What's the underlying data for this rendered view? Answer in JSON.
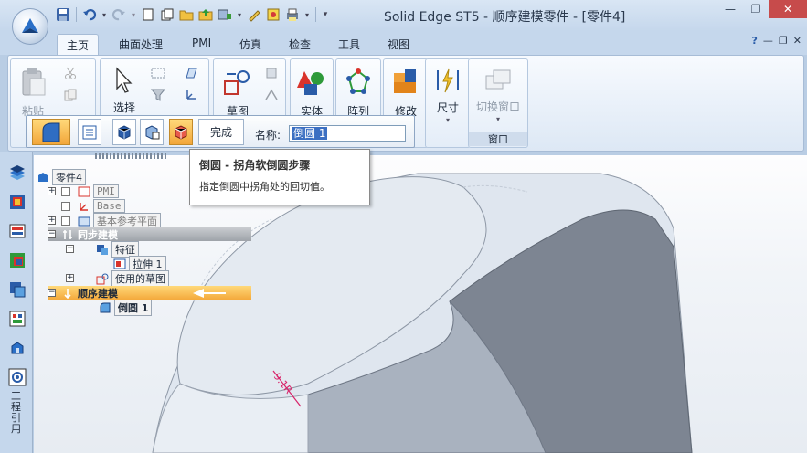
{
  "app": {
    "title": "Solid Edge ST5 - 顺序建模零件 - [零件4]"
  },
  "window_controls": {
    "minimize": "—",
    "restore": "❐",
    "close": "✕"
  },
  "tabs": [
    {
      "label": "主页",
      "active": true
    },
    {
      "label": "曲面处理"
    },
    {
      "label": "PMI"
    },
    {
      "label": "仿真"
    },
    {
      "label": "检查"
    },
    {
      "label": "工具"
    },
    {
      "label": "视图"
    }
  ],
  "tabs_right": {
    "help": "?",
    "min": "—",
    "restore": "❐",
    "close": "✕"
  },
  "ribbon": {
    "paste": "粘贴",
    "select": "选择",
    "sketch": "草图",
    "solid": "实体",
    "pattern": "阵列",
    "modify": "修改",
    "dimension": "尺寸",
    "switch_window": "切换窗口",
    "window_group": "窗口"
  },
  "command_bar": {
    "done_label": "完成",
    "name_label": "名称:",
    "name_value": "倒圆 1"
  },
  "tooltip": {
    "title": "倒圆 - 拐角软倒圆步骤",
    "body": "指定倒圆中拐角处的回切值。"
  },
  "tree": {
    "root": "零件4",
    "pmi": "PMI",
    "base": "Base",
    "ref_planes": "基本参考平面",
    "sync": "同步建模",
    "features": "特征",
    "extrude": "拉伸 1",
    "used_sketches": "使用的草图",
    "ordered": "顺序建模",
    "round": "倒圆 1"
  },
  "left_toolbar": {
    "engineering_reference": "工程引用"
  },
  "viewport": {
    "dimension_annotation": "9.1R"
  },
  "colors": {
    "ribbon_bg": "#e4edf8",
    "active_step": "#f2a63a",
    "model_face": "#dfe6ef",
    "model_side": "#7d8592",
    "close_button": "#c74b4b"
  }
}
